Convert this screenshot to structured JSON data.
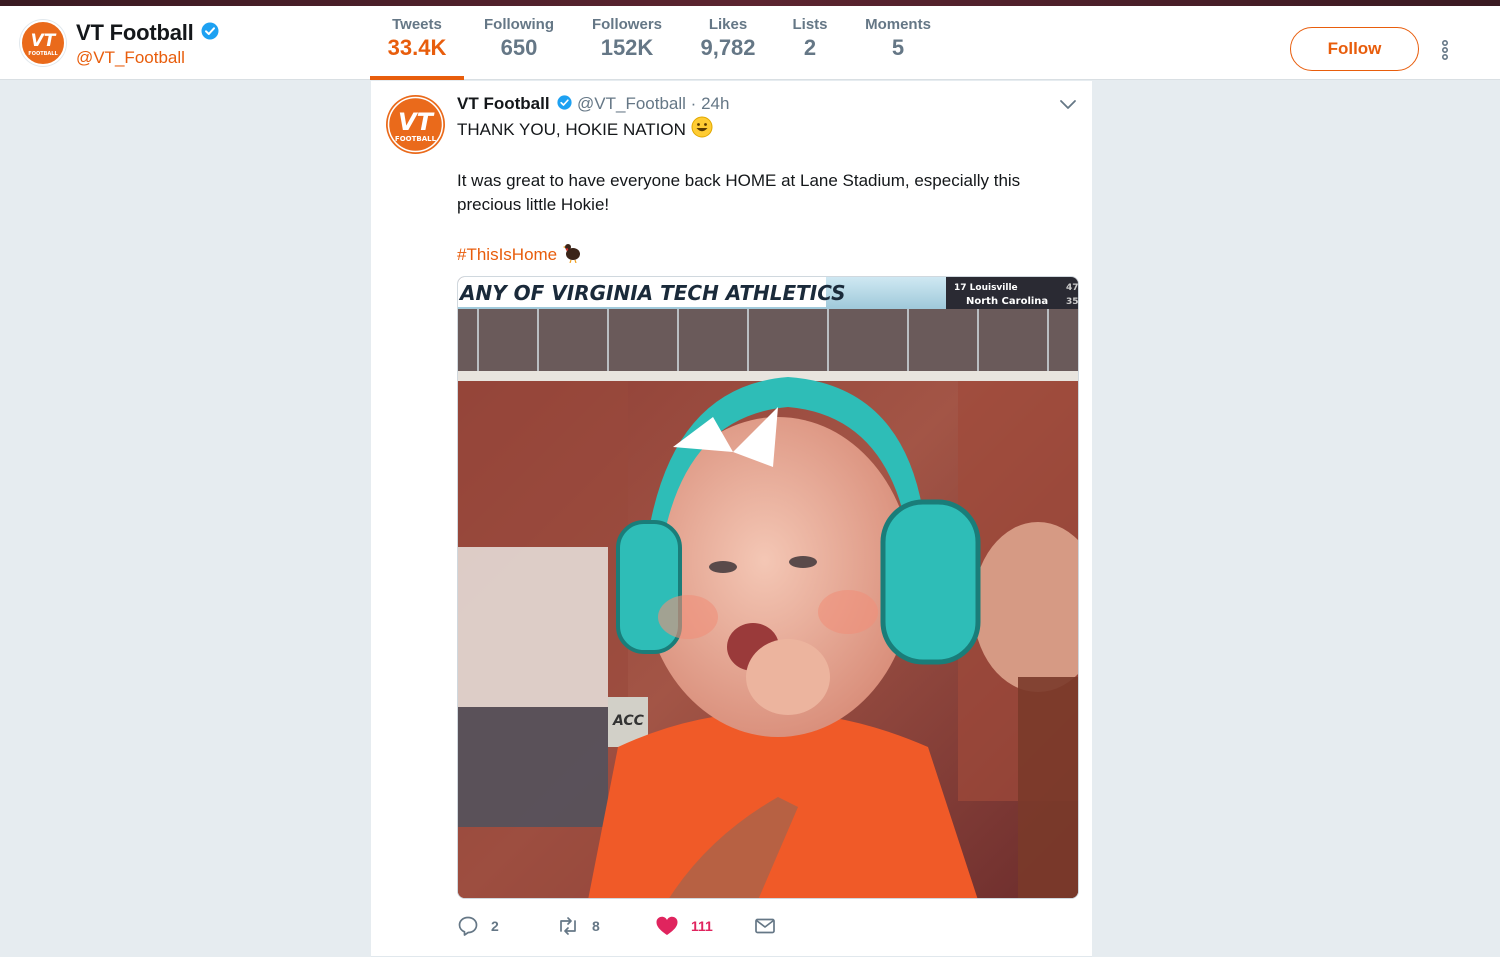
{
  "profile": {
    "display_name": "VT Football",
    "handle": "@VT_Football",
    "verified": true,
    "accent_color": "#e85d0c"
  },
  "nav": [
    {
      "label": "Tweets",
      "value": "33.4K",
      "active": true
    },
    {
      "label": "Following",
      "value": "650",
      "active": false
    },
    {
      "label": "Followers",
      "value": "152K",
      "active": false
    },
    {
      "label": "Likes",
      "value": "9,782",
      "active": false
    },
    {
      "label": "Lists",
      "value": "2",
      "active": false
    },
    {
      "label": "Moments",
      "value": "5",
      "active": false
    }
  ],
  "follow_label": "Follow",
  "tweet": {
    "name": "VT Football",
    "handle": "@VT_Football",
    "separator": "·",
    "time": "24h",
    "line1": "THANK YOU, HOKIE NATION",
    "line2": "It was great to have everyone back HOME at Lane Stadium, especially this precious little Hokie!",
    "hashtag": "#ThisIsHome",
    "photo": {
      "banner_text": "ANY OF VIRGINIA TECH ATHLETICS",
      "score_row1_team": "17 Louisville",
      "score_row1_score": "47",
      "score_row2_team": "North Carolina",
      "score_row2_score": "35",
      "sign_text": "ACC"
    },
    "actions": {
      "replies": "2",
      "retweets": "8",
      "likes": "111"
    }
  },
  "logo": {
    "letters": "VT",
    "word": "FOOTBALL"
  }
}
